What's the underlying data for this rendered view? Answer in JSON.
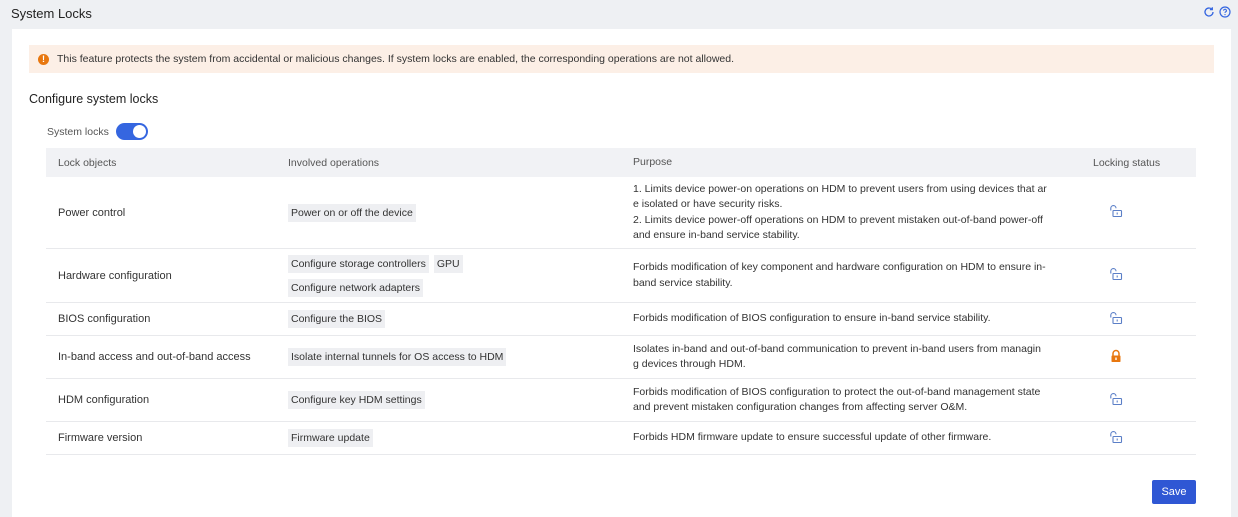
{
  "header": {
    "title": "System Locks",
    "icons": [
      "refresh-icon",
      "help-icon"
    ]
  },
  "notice": {
    "icon": "warning-icon",
    "text": "This feature protects the system from accidental or malicious changes. If system locks are enabled, the corresponding operations are not allowed."
  },
  "section": {
    "title": "Configure system locks"
  },
  "switch": {
    "label": "System locks",
    "enabled": true
  },
  "table": {
    "columns": [
      "Lock objects",
      "Involved operations",
      "Purpose",
      "Locking status"
    ],
    "rows": [
      {
        "object": "Power control",
        "operations": [
          "Power on or off the device"
        ],
        "purpose_lines": [
          "1. Limits device power-on operations on HDM to prevent users from using devices that ar",
          "e isolated or have security risks.",
          "2. Limits device power-off operations on HDM to prevent mistaken out-of-band power-off",
          "and ensure in-band service stability."
        ],
        "status": "unlocked"
      },
      {
        "object": "Hardware configuration",
        "operations": [
          "Configure storage controllers",
          "GPU",
          "Configure network adapters"
        ],
        "purpose_lines": [
          "Forbids modification of key component and hardware configuration on HDM to ensure in-",
          "band service stability."
        ],
        "status": "unlocked"
      },
      {
        "object": "BIOS configuration",
        "operations": [
          "Configure the BIOS"
        ],
        "purpose_lines": [
          "Forbids modification of BIOS configuration to ensure in-band service stability."
        ],
        "status": "unlocked"
      },
      {
        "object": "In-band access and out-of-band access",
        "operations": [
          "Isolate internal tunnels for OS access to HDM"
        ],
        "purpose_lines": [
          "Isolates in-band and out-of-band communication to prevent in-band users from managin",
          "g devices through HDM."
        ],
        "status": "locked"
      },
      {
        "object": "HDM configuration",
        "operations": [
          "Configure key HDM settings"
        ],
        "purpose_lines": [
          "Forbids modification of BIOS configuration to protect the out-of-band management state",
          "and prevent mistaken configuration changes from affecting server O&M."
        ],
        "status": "unlocked"
      },
      {
        "object": "Firmware version",
        "operations": [
          "Firmware update"
        ],
        "purpose_lines": [
          "Forbids HDM firmware update to ensure successful update of other firmware."
        ],
        "status": "unlocked"
      }
    ]
  },
  "actions": {
    "save_label": "Save"
  },
  "colors": {
    "accent": "#2f57d4",
    "toggle": "#3566e0",
    "warning": "#e8770f",
    "locked": "#e8770f",
    "unlocked_icon": "#5b7fc7"
  }
}
